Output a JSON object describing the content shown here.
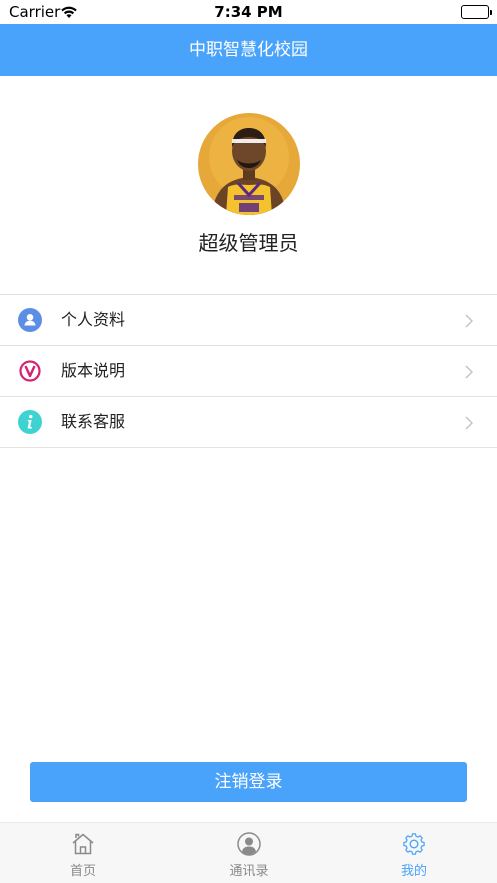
{
  "status_bar": {
    "carrier": "Carrier",
    "time": "7:34 PM"
  },
  "nav": {
    "title": "中职智慧化校园"
  },
  "profile": {
    "name": "超级管理员",
    "avatar_icon": "user-avatar-photo"
  },
  "menu": {
    "items": [
      {
        "label": "个人资料",
        "icon": "user-icon",
        "icon_color": "#5b8fe6"
      },
      {
        "label": "版本说明",
        "icon": "version-v-icon",
        "icon_color": "#d6226f"
      },
      {
        "label": "联系客服",
        "icon": "info-icon",
        "icon_color": "#3ed3d0"
      }
    ]
  },
  "logout": {
    "label": "注销登录"
  },
  "tab_bar": {
    "tabs": [
      {
        "label": "首页",
        "icon": "home-icon",
        "active": false
      },
      {
        "label": "通讯录",
        "icon": "contacts-icon",
        "active": false
      },
      {
        "label": "我的",
        "icon": "gear-icon",
        "active": true
      }
    ]
  },
  "colors": {
    "accent": "#4aa3fa",
    "inactive_tab": "#8a8a8a",
    "divider": "#e3e3e3"
  }
}
